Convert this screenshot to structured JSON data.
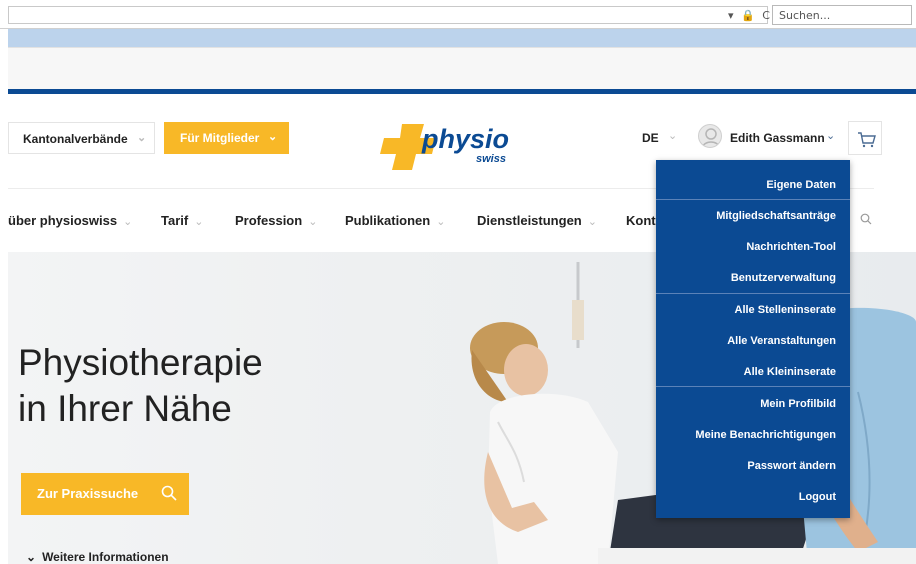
{
  "browser": {
    "search_placeholder": "Suchen...",
    "address_icons": "▾ 🔒 C"
  },
  "header": {
    "kantonal_label": "Kantonalverbände",
    "mitglieder_label": "Für Mitglieder",
    "logo_main": "physio",
    "logo_sub": "swiss",
    "language": "DE",
    "user_name": "Edith Gassmann"
  },
  "nav": {
    "items": [
      {
        "label": "über physioswiss"
      },
      {
        "label": "Tarif"
      },
      {
        "label": "Profession"
      },
      {
        "label": "Publikationen"
      },
      {
        "label": "Dienstleistungen"
      },
      {
        "label": "Kont"
      }
    ]
  },
  "hero": {
    "title_line1": "Physiotherapie",
    "title_line2": "in Ihrer Nähe",
    "button_label": "Zur Praxissuche",
    "more_label": "Weitere Informationen"
  },
  "user_menu": {
    "items": [
      {
        "label": "Eigene Daten"
      },
      {
        "label": "Mitgliedschaftsanträge"
      },
      {
        "label": "Nachrichten-Tool"
      },
      {
        "label": "Benutzerverwaltung"
      },
      {
        "label": "Alle Stelleninserate"
      },
      {
        "label": "Alle Veranstaltungen"
      },
      {
        "label": "Alle Kleininserate"
      },
      {
        "label": "Mein Profilbild"
      },
      {
        "label": "Meine Benachrichtigungen"
      },
      {
        "label": "Passwort ändern"
      },
      {
        "label": "Logout"
      }
    ]
  },
  "colors": {
    "brand_blue": "#0b4a93",
    "brand_yellow": "#f8b827"
  }
}
